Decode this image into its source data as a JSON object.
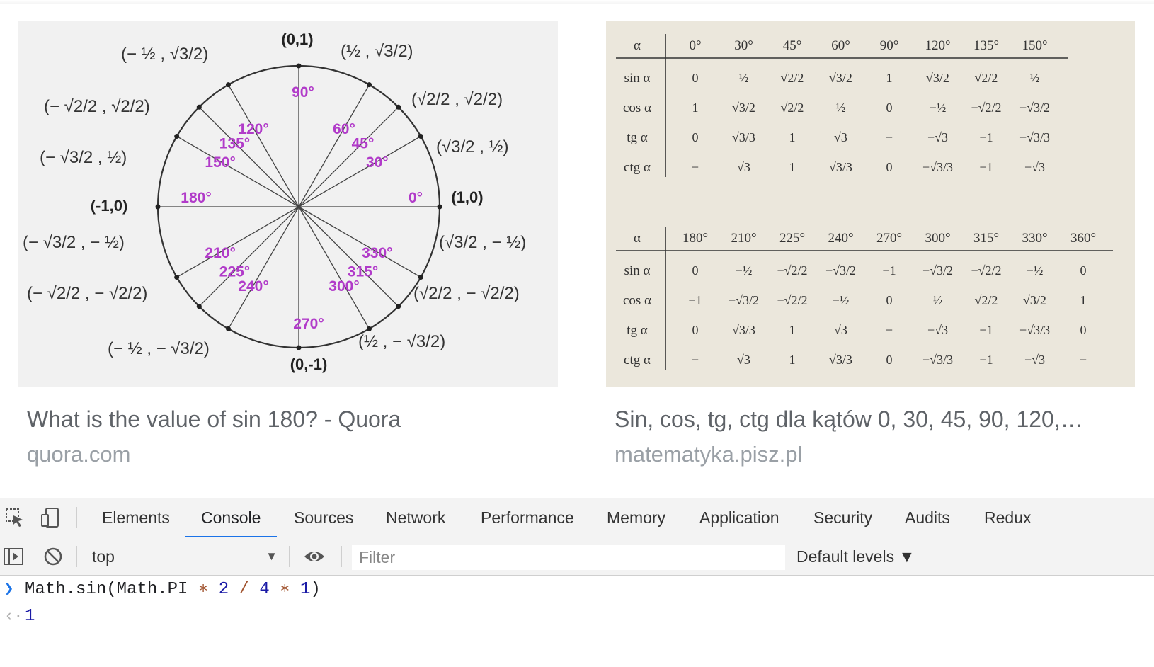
{
  "results": [
    {
      "title": "What is the value of sin 180? - Quora",
      "site": "quora.com",
      "image": {
        "angles": [
          "0°",
          "30°",
          "45°",
          "60°",
          "90°",
          "120°",
          "135°",
          "150°",
          "180°",
          "210°",
          "225°",
          "240°",
          "270°",
          "300°",
          "315°",
          "330°"
        ],
        "axis_points": {
          "top": "(0,1)",
          "bottom": "(0,-1)",
          "left": "(-1,0)",
          "right": "(1,0)"
        }
      }
    },
    {
      "title": "Sin, cos, tg, ctg dla kątów 0, 30, 45, 90, 120,…",
      "site": "matematyka.pisz.pl",
      "image": {
        "table1": {
          "header": [
            "α",
            "0°",
            "30°",
            "45°",
            "60°",
            "90°",
            "120°",
            "135°",
            "150°"
          ],
          "rows": [
            [
              "sin α",
              "0",
              "½",
              "√2/2",
              "√3/2",
              "1",
              "√3/2",
              "√2/2",
              "½"
            ],
            [
              "cos α",
              "1",
              "√3/2",
              "√2/2",
              "½",
              "0",
              "−½",
              "−√2/2",
              "−√3/2"
            ],
            [
              "tg α",
              "0",
              "√3/3",
              "1",
              "√3",
              "−",
              "−√3",
              "−1",
              "−√3/3"
            ],
            [
              "ctg α",
              "−",
              "√3",
              "1",
              "√3/3",
              "0",
              "−√3/3",
              "−1",
              "−√3"
            ]
          ]
        },
        "table2": {
          "header": [
            "α",
            "180°",
            "210°",
            "225°",
            "240°",
            "270°",
            "300°",
            "315°",
            "330°",
            "360°"
          ],
          "rows": [
            [
              "sin α",
              "0",
              "−½",
              "−√2/2",
              "−√3/2",
              "−1",
              "−√3/2",
              "−√2/2",
              "−½",
              "0"
            ],
            [
              "cos α",
              "−1",
              "−√3/2",
              "−√2/2",
              "−½",
              "0",
              "½",
              "√2/2",
              "√3/2",
              "1"
            ],
            [
              "tg α",
              "0",
              "√3/3",
              "1",
              "√3",
              "−",
              "−√3",
              "−1",
              "−√3/3",
              "0"
            ],
            [
              "ctg α",
              "−",
              "√3",
              "1",
              "√3/3",
              "0",
              "−√3/3",
              "−1",
              "−√3",
              "−"
            ]
          ]
        }
      }
    }
  ],
  "devtools": {
    "tabs": [
      "Elements",
      "Console",
      "Sources",
      "Network",
      "Performance",
      "Memory",
      "Application",
      "Security",
      "Audits",
      "Redux"
    ],
    "active_tab": "Console",
    "context": "top",
    "filter_placeholder": "Filter",
    "levels_label": "Default levels ▼",
    "console": {
      "input_parts": [
        "Math.sin(Math.PI ",
        "∗",
        " ",
        "2",
        " ",
        "/",
        " ",
        "4",
        " ",
        "∗",
        " ",
        "1",
        ")"
      ],
      "output": "1"
    },
    "icons": [
      "inspect-element-icon",
      "device-toolbar-icon",
      "sidebar-toggle-icon",
      "clear-console-icon",
      "eye-icon",
      "dropdown-arrow-icon"
    ]
  }
}
